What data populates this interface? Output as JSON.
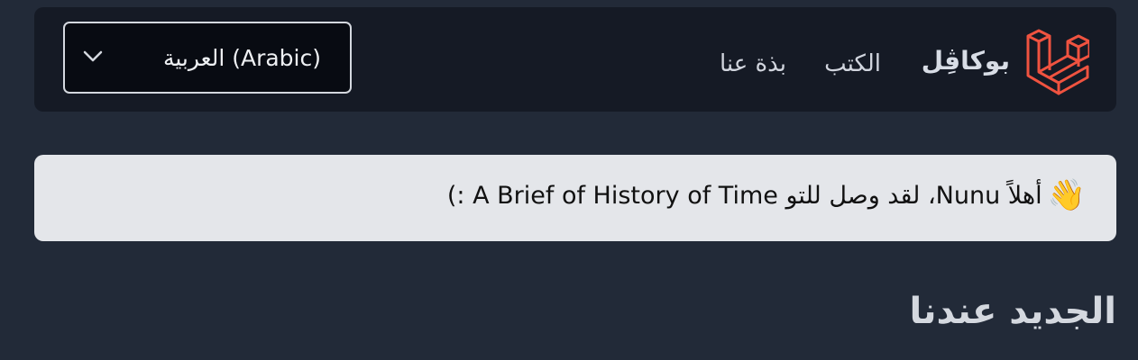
{
  "header": {
    "brand": "بوكاڤِل",
    "logo_icon": "laravel-logo-icon",
    "nav": [
      {
        "label": "الكتب"
      },
      {
        "label": "بذة عنا"
      }
    ],
    "language_select": {
      "selected": "العربية (Arabic)",
      "icon": "chevron-down-icon"
    }
  },
  "welcome": {
    "icon": "waving-hand-icon",
    "text": "أهلاً Nunu، لقد وصل للتو A Brief of History of Time :)"
  },
  "section": {
    "title": "الجديد عندنا"
  },
  "colors": {
    "accent": "#f05340",
    "background": "#222a38",
    "navbar": "#151a25",
    "alert": "#e4e6ea"
  }
}
